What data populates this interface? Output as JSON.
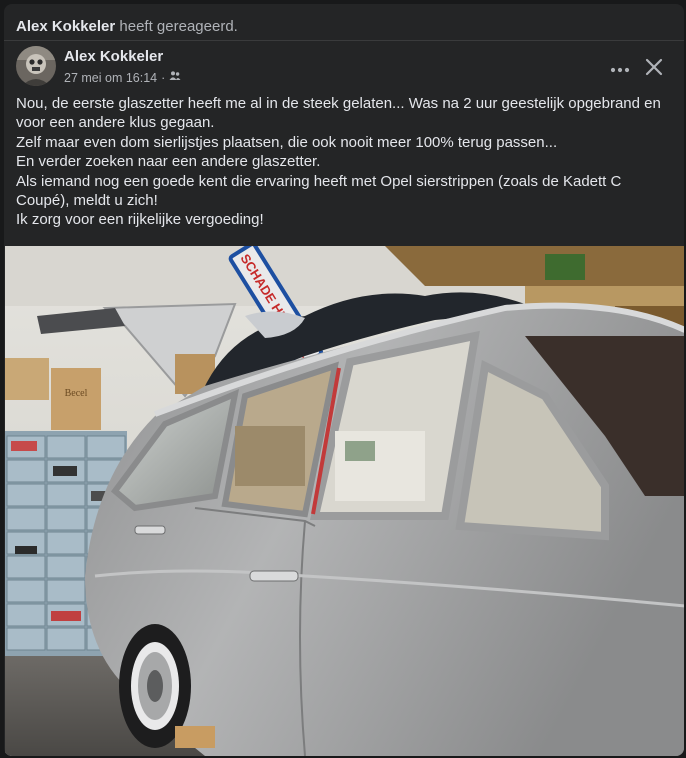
{
  "reaction": {
    "actor": "Alex Kokkeler",
    "action": "heeft gereageerd."
  },
  "post": {
    "author": "Alex Kokkeler",
    "timestamp": "27 mei om 16:14",
    "audience_icon": "friends-icon",
    "lines": [
      "Nou, de eerste glaszetter heeft me al in de steek gelaten... Was na 2 uur geestelijk opgebrand en",
      "voor een andere klus gegaan.",
      "Zelf maar even dom sierlijstjes plaatsen, die ook nooit meer 100% terug passen...",
      "En verder zoeken naar een andere glaszetter.",
      "Als iemand nog een goede kent die ervaring heeft met Opel sierstrippen (zoals de Kadett C",
      "Coupé), meldt u zich!",
      "Ik zorg voor een rijkelijke vergoeding!"
    ],
    "photo_sign_text": "SCHADE HERSTEL"
  },
  "actions": {
    "more_icon": "more-options-icon",
    "close_icon": "close-icon"
  },
  "colors": {
    "background": "#18191a",
    "card": "#242526",
    "text_primary": "#e4e6eb",
    "text_secondary": "#b0b3b8",
    "car_silver": "#a9aaab"
  }
}
